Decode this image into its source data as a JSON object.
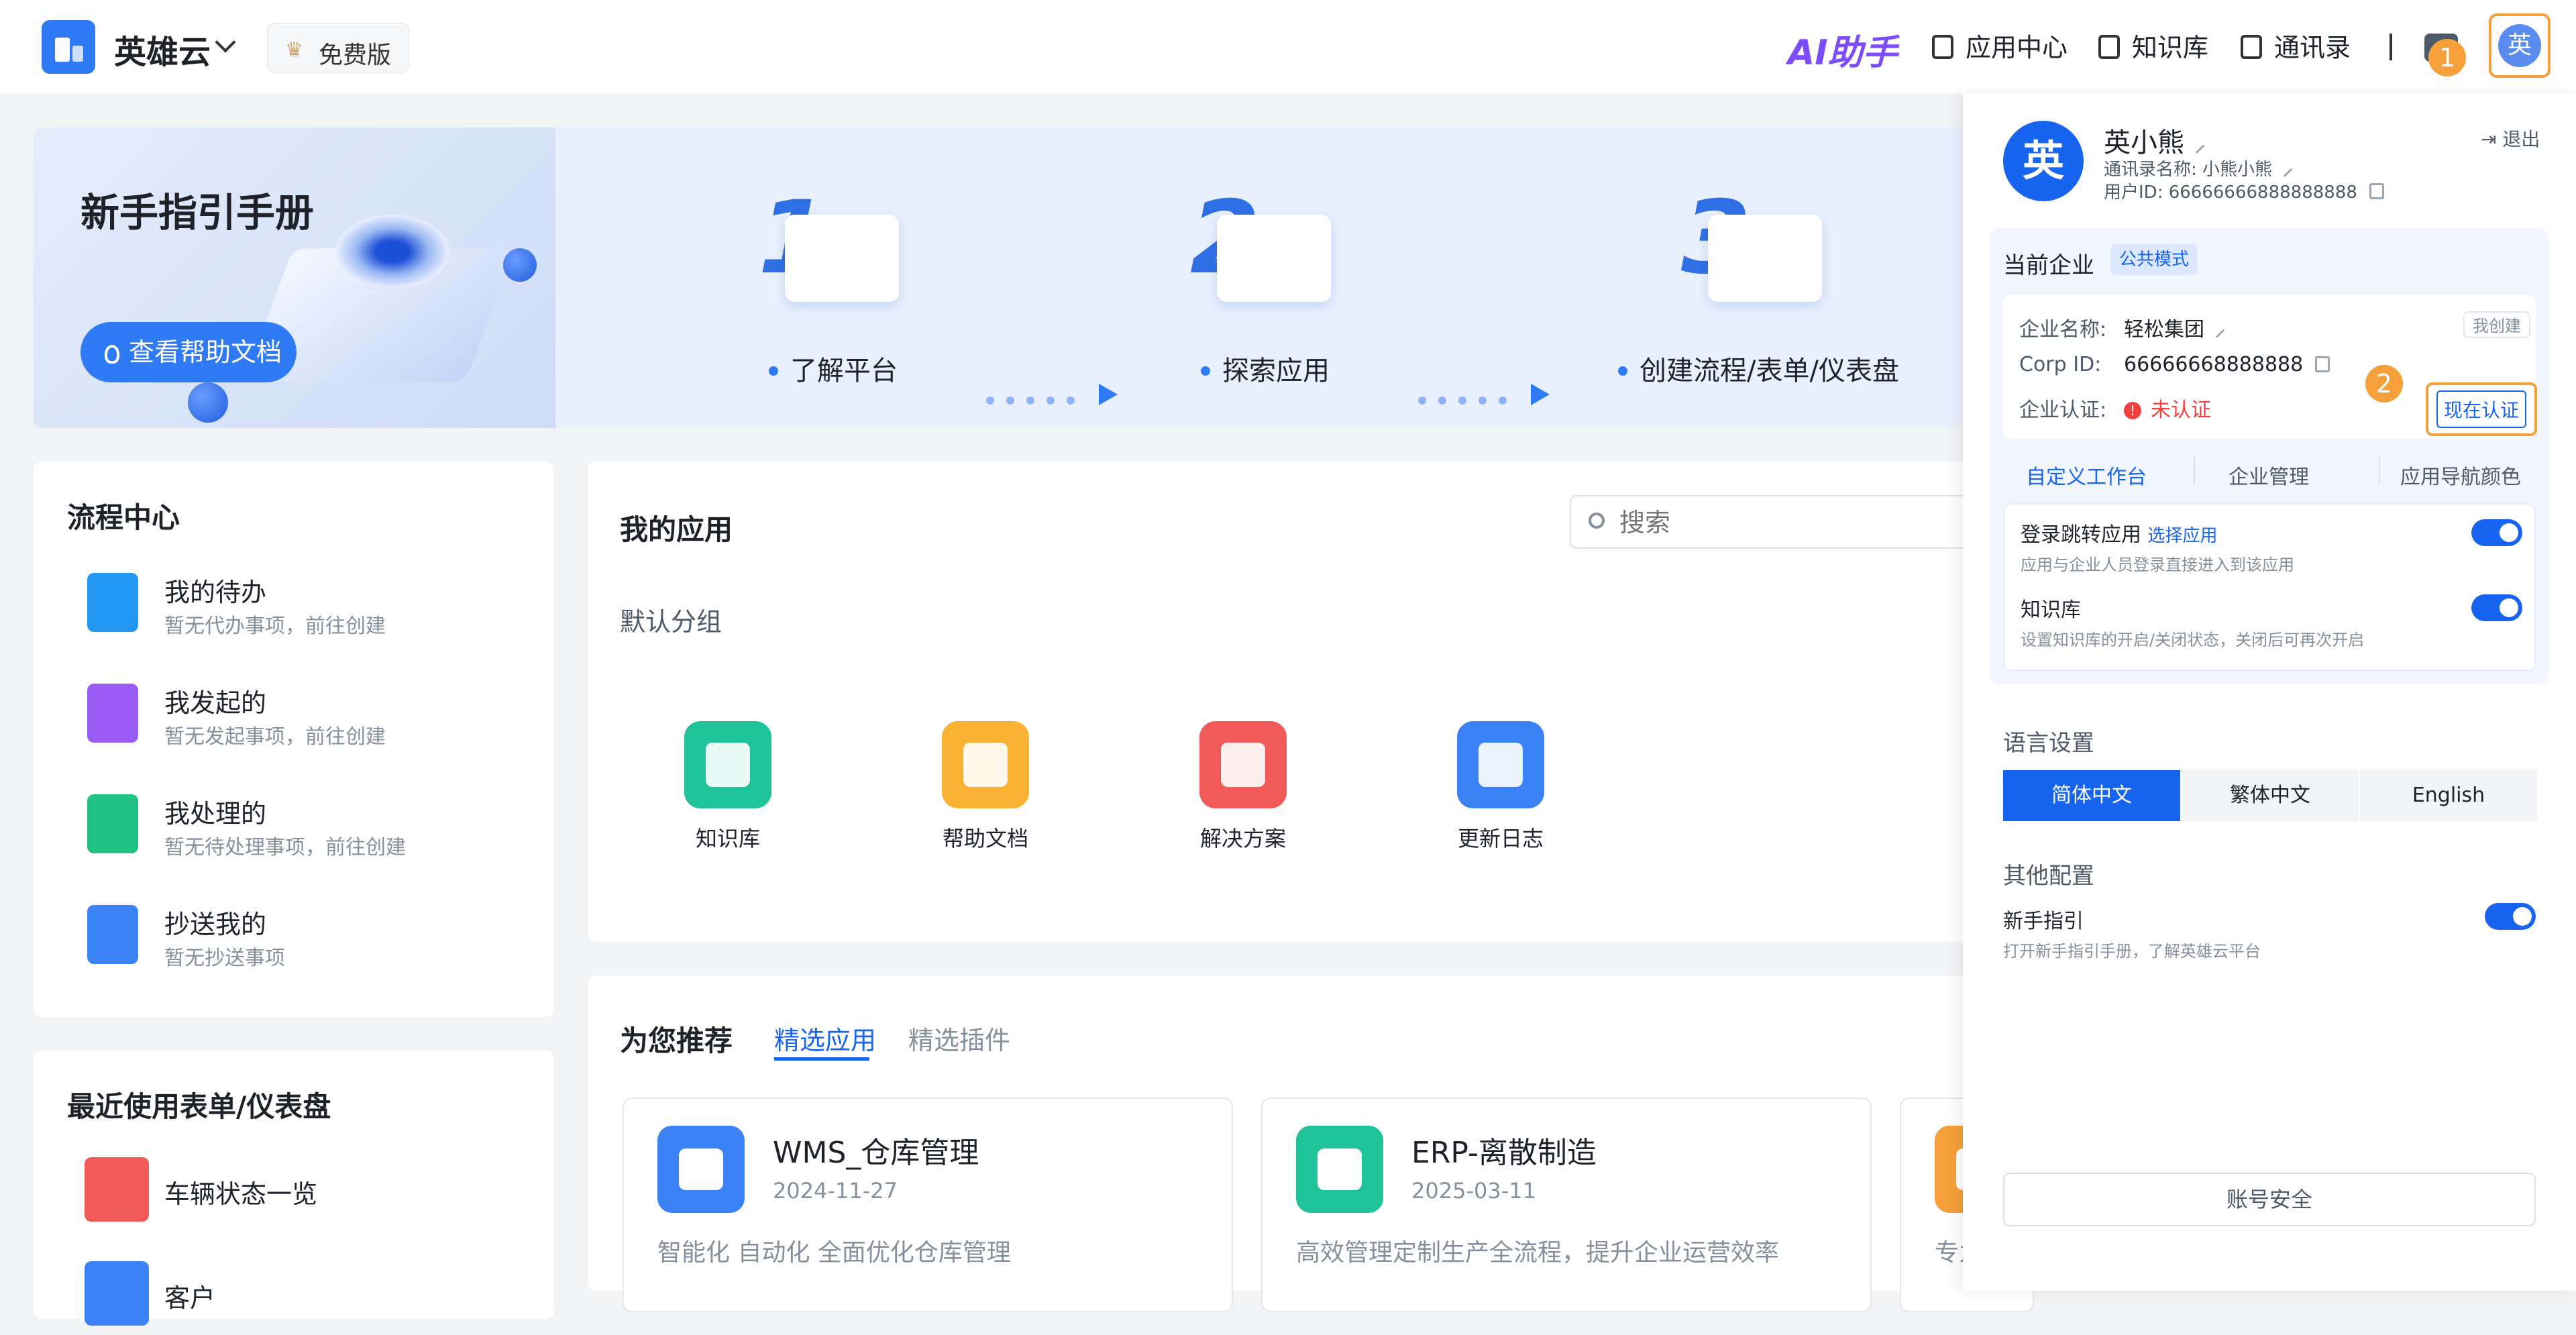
{
  "header": {
    "brand": "英雄云",
    "plan": "免费版",
    "ai_label": "AI助手",
    "nav": [
      "应用中心",
      "知识库",
      "通讯录"
    ],
    "avatar_char": "英",
    "step1": "1",
    "step2": "2"
  },
  "banner": {
    "title": "新手指引手册",
    "help_button": "查看帮助文档",
    "steps": [
      {
        "num": "1",
        "label": "了解平台"
      },
      {
        "num": "2",
        "label": "探索应用"
      },
      {
        "num": "3",
        "label": "创建流程/表单/仪表盘"
      }
    ]
  },
  "flow": {
    "title": "流程中心",
    "items": [
      {
        "title": "我的待办",
        "sub": "暂无代办事项，前往创建"
      },
      {
        "title": "我发起的",
        "sub": "暂无发起事项，前往创建"
      },
      {
        "title": "我处理的",
        "sub": "暂无待处理事项，前往创建"
      },
      {
        "title": "抄送我的",
        "sub": "暂无抄送事项"
      }
    ]
  },
  "recent": {
    "title": "最近使用表单/仪表盘",
    "items": [
      "车辆状态一览",
      "客户"
    ]
  },
  "apps": {
    "title": "我的应用",
    "search_placeholder": "搜索",
    "group": "默认分组",
    "list": [
      "知识库",
      "帮助文档",
      "解决方案",
      "更新日志"
    ]
  },
  "recommend": {
    "title": "为您推荐",
    "tabs": [
      "精选应用",
      "精选插件"
    ],
    "cards": [
      {
        "name": "WMS_仓库管理",
        "date": "2024-11-27",
        "desc": "智能化 自动化 全面优化仓库管理"
      },
      {
        "name": "ERP-离散制造",
        "date": "2025-03-11",
        "desc": "高效管理定制生产全流程，提升企业运营效率"
      },
      {
        "desc": "专为"
      }
    ]
  },
  "panel": {
    "avatar_char": "英",
    "name": "英小熊",
    "contact_name_label": "通讯录名称: 小熊小熊",
    "user_id_label": "用户ID: 66666666888888888",
    "logout": "退出",
    "current_ent": "当前企业",
    "public_mode": "公共模式",
    "ent_name_label": "企业名称:",
    "ent_name": "轻松集团",
    "created_tag": "我创建",
    "corp_id_label": "Corp ID:",
    "corp_id": "66666668888888",
    "cert_label": "企业认证:",
    "cert_status": "未认证",
    "verify_button": "现在认证",
    "links": [
      "自定义工作台",
      "企业管理",
      "应用导航颜色"
    ],
    "login_jump": "登录跳转应用",
    "choose_app": "选择应用",
    "login_jump_desc": "应用与企业人员登录直接进入到该应用",
    "kb": "知识库",
    "kb_desc": "设置知识库的开启/关闭状态，关闭后可再次开启",
    "lang_title": "语言设置",
    "langs": [
      "简体中文",
      "繁体中文",
      "English"
    ],
    "other_title": "其他配置",
    "guide": "新手指引",
    "guide_desc": "打开新手指引手册，了解英雄云平台",
    "account_security": "账号安全"
  },
  "colors": {
    "primary": "#1664f0",
    "accent_orange": "#f6a03c",
    "danger": "#f53f3f"
  }
}
